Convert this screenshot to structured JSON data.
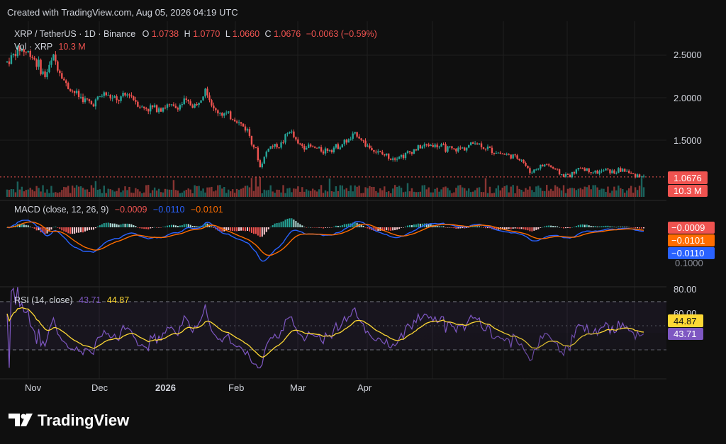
{
  "header": {
    "created_with": "Created with TradingView.com, Aug 05, 2026 04:19 UTC"
  },
  "symbol": {
    "title": "XRP / TetherUS · 1D · Binance",
    "open_label": "O",
    "open": "1.0738",
    "high_label": "H",
    "high": "1.0770",
    "low_label": "L",
    "low": "1.0660",
    "close_label": "C",
    "close": "1.0676",
    "change": "−0.0063 (−0.59%)"
  },
  "volume": {
    "label": "Vol · XRP",
    "value": "10.3 M",
    "badge": "10.3 M"
  },
  "macd": {
    "label": "MACD (close, 12, 26, 9)",
    "hist": "−0.0009",
    "macd": "−0.0110",
    "signal": "−0.0101",
    "badge_hist": "−0.0009",
    "badge_signal": "−0.0101",
    "badge_macd": "−0.0110",
    "partial_tick": "0.1000"
  },
  "rsi": {
    "label": "RSI (14, close)",
    "rsi": "43.71",
    "ma": "44.87",
    "badge_ma": "44.87",
    "badge_rsi": "43.71"
  },
  "last_price_badge": "1.0676",
  "logo_text": "TradingView",
  "colors": {
    "bull": "#26a69a",
    "bear": "#ef5350",
    "macd_line": "#2962ff",
    "signal_line": "#ff6d00",
    "rsi_line": "#7e57c2",
    "rsi_ma": "#fdd835"
  },
  "chart_data": [
    {
      "type": "candlestick",
      "title": "XRP / TetherUS · 1D · Binance",
      "x_labels": [
        "Nov",
        "Dec",
        "2026",
        "Feb",
        "Mar",
        "Apr"
      ],
      "y_ticks": [
        "2.5000",
        "2.0000",
        "1.5000"
      ],
      "ylim": [
        1.0,
        2.75
      ],
      "price_path": [
        [
          0,
          2.42
        ],
        [
          6,
          2.58
        ],
        [
          12,
          2.5
        ],
        [
          18,
          2.25
        ],
        [
          22,
          2.48
        ],
        [
          28,
          2.15
        ],
        [
          34,
          2.02
        ],
        [
          40,
          1.92
        ],
        [
          46,
          2.05
        ],
        [
          52,
          1.96
        ],
        [
          58,
          2.05
        ],
        [
          64,
          1.88
        ],
        [
          70,
          1.88
        ],
        [
          76,
          1.9
        ],
        [
          80,
          1.88
        ],
        [
          84,
          1.95
        ],
        [
          90,
          1.9
        ],
        [
          94,
          2.15
        ],
        [
          98,
          1.85
        ],
        [
          102,
          1.82
        ],
        [
          108,
          1.75
        ],
        [
          114,
          1.62
        ],
        [
          118,
          1.38
        ],
        [
          120,
          1.18
        ],
        [
          124,
          1.42
        ],
        [
          130,
          1.45
        ],
        [
          134,
          1.62
        ],
        [
          138,
          1.45
        ],
        [
          144,
          1.42
        ],
        [
          150,
          1.38
        ],
        [
          156,
          1.42
        ],
        [
          162,
          1.5
        ],
        [
          166,
          1.58
        ],
        [
          170,
          1.45
        ],
        [
          176,
          1.35
        ],
        [
          182,
          1.3
        ],
        [
          188,
          1.32
        ],
        [
          194,
          1.4
        ],
        [
          200,
          1.45
        ],
        [
          206,
          1.42
        ],
        [
          212,
          1.38
        ],
        [
          218,
          1.42
        ],
        [
          222,
          1.48
        ],
        [
          226,
          1.42
        ],
        [
          232,
          1.36
        ],
        [
          238,
          1.32
        ],
        [
          244,
          1.28
        ],
        [
          248,
          1.12
        ],
        [
          252,
          1.18
        ],
        [
          256,
          1.22
        ],
        [
          260,
          1.15
        ],
        [
          264,
          1.08
        ],
        [
          268,
          1.1
        ],
        [
          272,
          1.18
        ],
        [
          276,
          1.14
        ],
        [
          280,
          1.12
        ],
        [
          284,
          1.15
        ],
        [
          288,
          1.12
        ],
        [
          292,
          1.16
        ],
        [
          296,
          1.1
        ],
        [
          300,
          1.09
        ],
        [
          302,
          1.0676
        ]
      ],
      "last_price": 1.0676
    },
    {
      "type": "bar",
      "title": "Vol · XRP",
      "last_value": "10.3 M"
    },
    {
      "type": "line",
      "title": "MACD (close, 12, 26, 9)",
      "series": [
        {
          "name": "MACD",
          "last": -0.011
        },
        {
          "name": "Signal",
          "last": -0.0101
        },
        {
          "name": "Histogram",
          "last": -0.0009
        }
      ]
    },
    {
      "type": "line",
      "title": "RSI (14, close)",
      "y_ticks": [
        "80.00",
        "60.00"
      ],
      "ylim": [
        10,
        90
      ],
      "bands": [
        30,
        50,
        70
      ],
      "series": [
        {
          "name": "RSI",
          "last": 43.71
        },
        {
          "name": "RSI-based MA",
          "last": 44.87
        }
      ]
    }
  ]
}
